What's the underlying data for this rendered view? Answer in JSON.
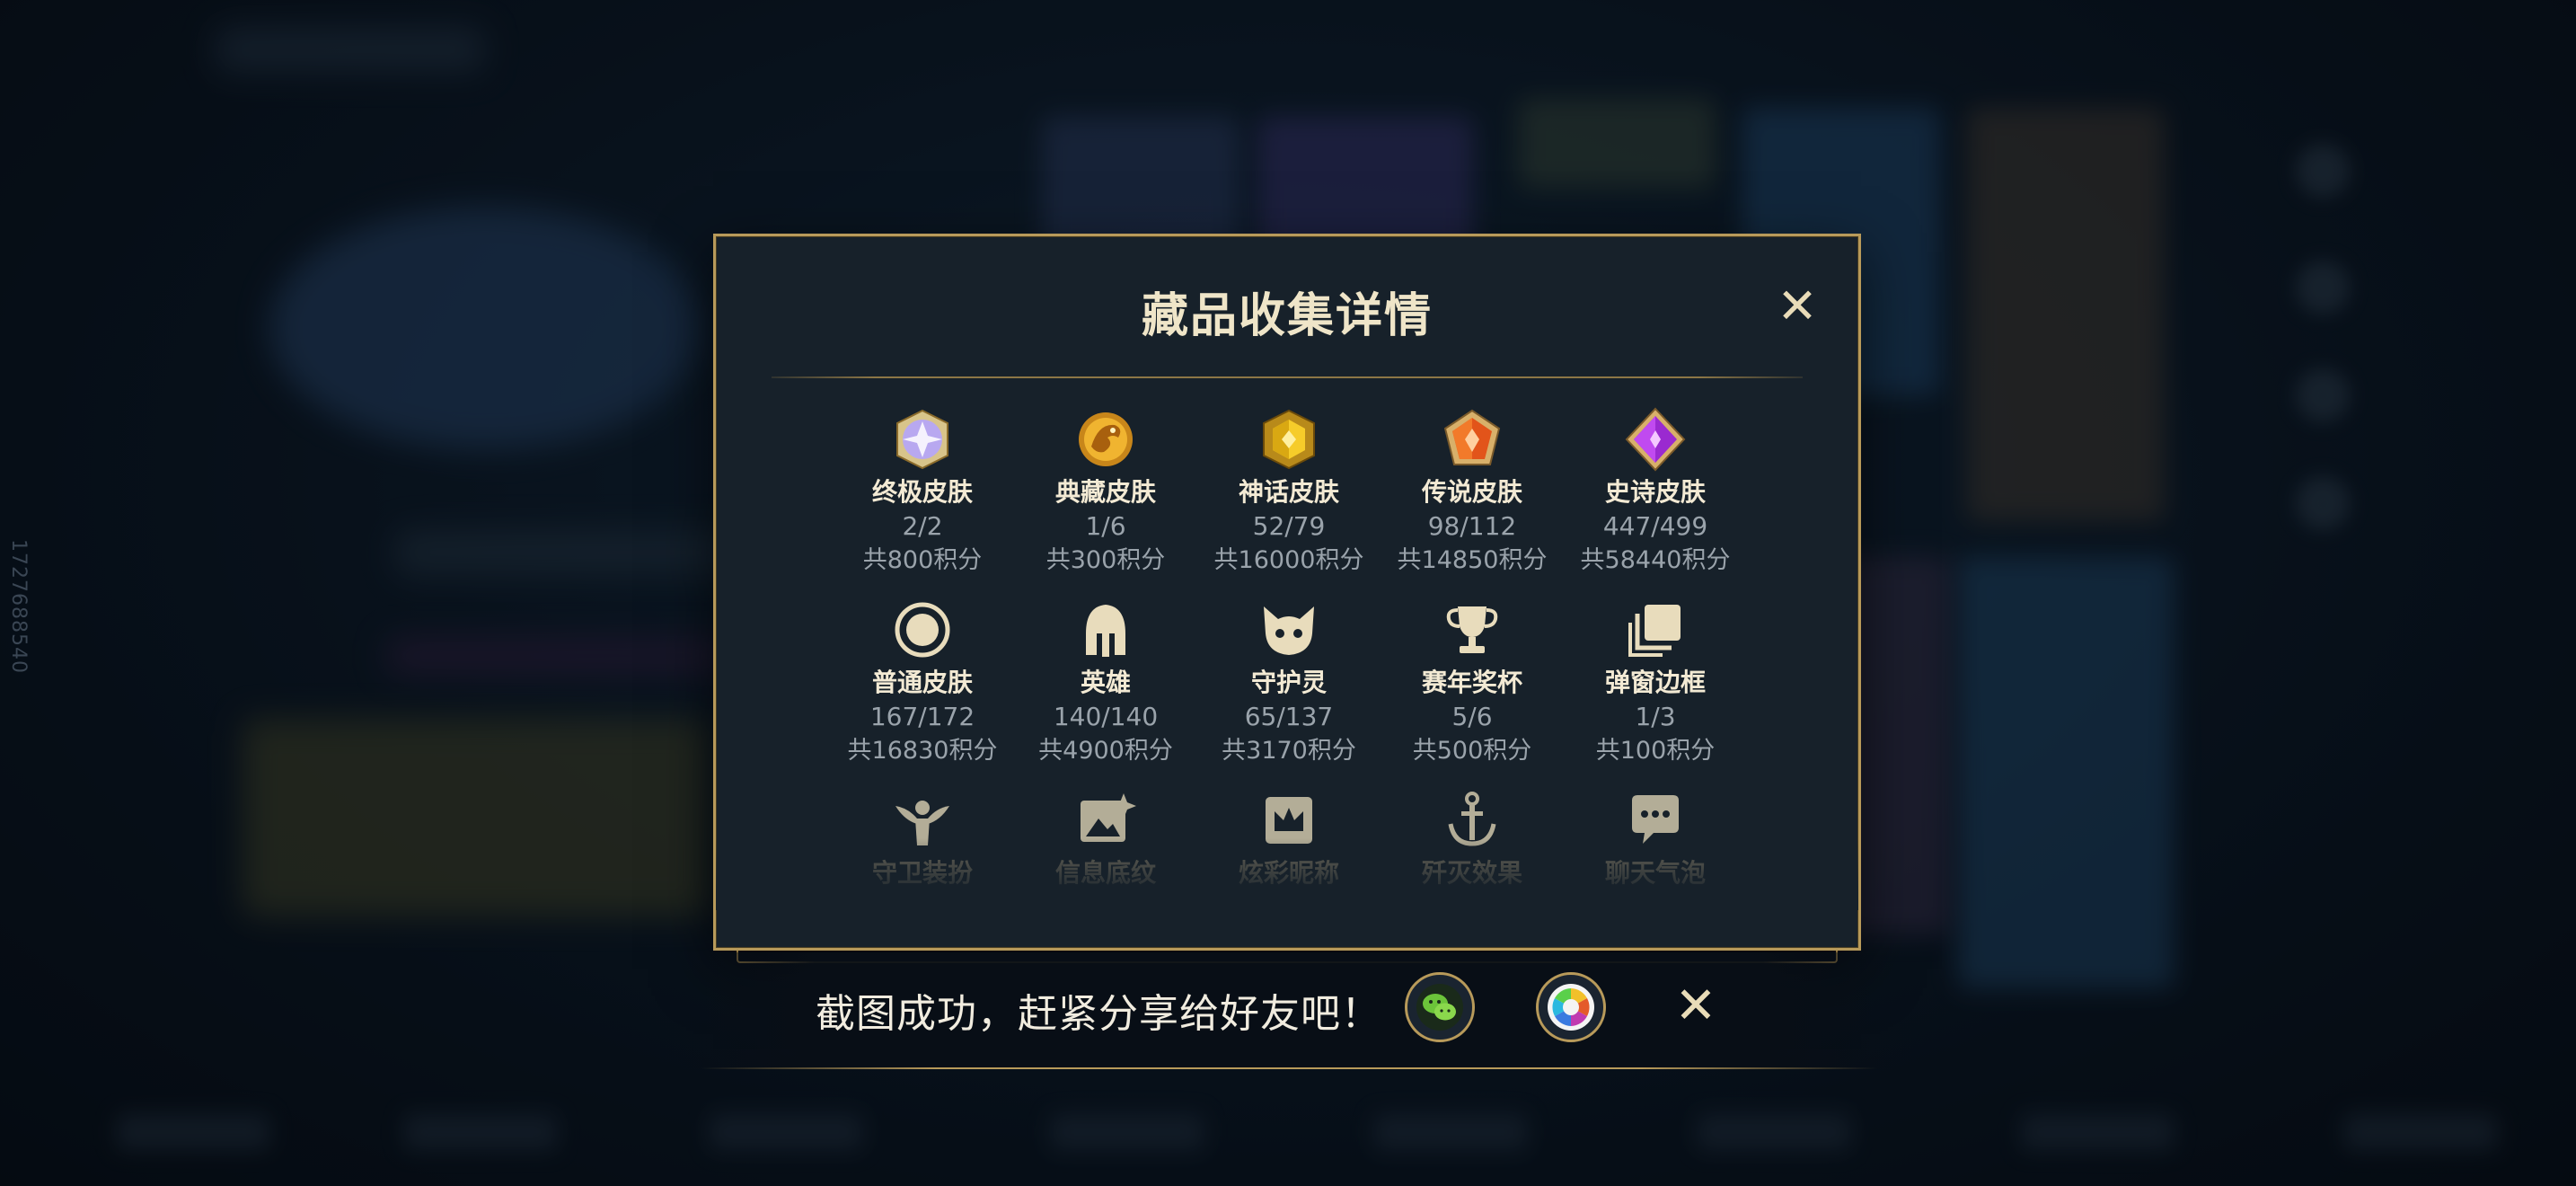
{
  "background": {
    "side_id": "1727688540"
  },
  "dialog": {
    "title": "藏品收集详情",
    "close_icon": "close-icon",
    "items": [
      {
        "id": "ultimate-skin",
        "icon": "ultimate-gem-icon",
        "name": "终极皮肤",
        "count": "2/2",
        "points": "共800积分"
      },
      {
        "id": "collector-skin",
        "icon": "dragon-emblem-icon",
        "name": "典藏皮肤",
        "count": "1/6",
        "points": "共300积分"
      },
      {
        "id": "myth-skin",
        "icon": "gold-gem-icon",
        "name": "神话皮肤",
        "count": "52/79",
        "points": "共16000积分"
      },
      {
        "id": "legend-skin",
        "icon": "orange-gem-icon",
        "name": "传说皮肤",
        "count": "98/112",
        "points": "共14850积分"
      },
      {
        "id": "epic-skin",
        "icon": "purple-gem-icon",
        "name": "史诗皮肤",
        "count": "447/499",
        "points": "共58440积分"
      },
      {
        "id": "normal-skin",
        "icon": "ring-icon",
        "name": "普通皮肤",
        "count": "167/172",
        "points": "共16830积分"
      },
      {
        "id": "hero",
        "icon": "helmet-icon",
        "name": "英雄",
        "count": "140/140",
        "points": "共4900积分"
      },
      {
        "id": "guardian-spirit",
        "icon": "cat-face-icon",
        "name": "守护灵",
        "count": "65/137",
        "points": "共3170积分"
      },
      {
        "id": "season-trophy",
        "icon": "trophy-icon",
        "name": "赛年奖杯",
        "count": "5/6",
        "points": "共500积分"
      },
      {
        "id": "popup-frame",
        "icon": "stacked-frames-icon",
        "name": "弹窗边框",
        "count": "1/3",
        "points": "共100积分"
      },
      {
        "id": "guard-outfit",
        "icon": "winged-figure-icon",
        "name": "守卫装扮",
        "count": "",
        "points": ""
      },
      {
        "id": "info-pattern",
        "icon": "image-sparkle-icon",
        "name": "信息底纹",
        "count": "",
        "points": ""
      },
      {
        "id": "colorful-nickname",
        "icon": "crown-card-icon",
        "name": "炫彩昵称",
        "count": "",
        "points": ""
      },
      {
        "id": "kill-effect",
        "icon": "anchor-icon",
        "name": "歼灭效果",
        "count": "",
        "points": ""
      },
      {
        "id": "chat-bubble",
        "icon": "chat-bubble-icon",
        "name": "聊天气泡",
        "count": "",
        "points": ""
      }
    ]
  },
  "share_bar": {
    "message": "截图成功，赶紧分享给好友吧！",
    "wechat_icon": "wechat-icon",
    "moments_icon": "moments-camera-icon",
    "close_icon": "close-icon"
  },
  "colors": {
    "gold": "#b89a5a",
    "panel": "#17212a",
    "title": "#efe5c8",
    "muted": "#9aa3ab"
  }
}
